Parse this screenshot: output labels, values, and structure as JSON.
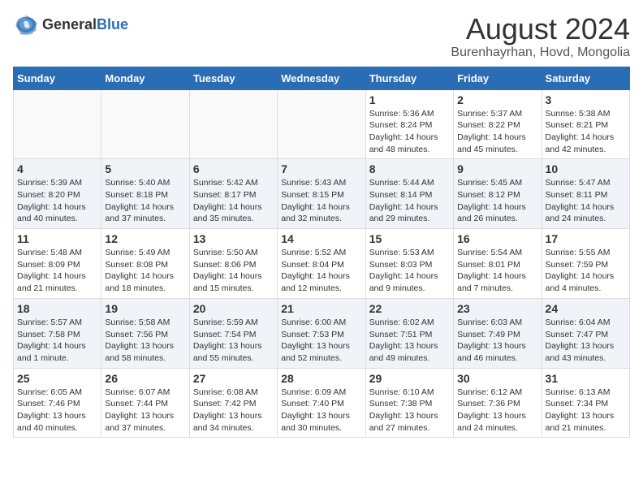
{
  "logo": {
    "general": "General",
    "blue": "Blue"
  },
  "title": "August 2024",
  "subtitle": "Burenhayrhan, Hovd, Mongolia",
  "weekdays": [
    "Sunday",
    "Monday",
    "Tuesday",
    "Wednesday",
    "Thursday",
    "Friday",
    "Saturday"
  ],
  "weeks": [
    [
      {
        "day": "",
        "info": ""
      },
      {
        "day": "",
        "info": ""
      },
      {
        "day": "",
        "info": ""
      },
      {
        "day": "",
        "info": ""
      },
      {
        "day": "1",
        "info": "Sunrise: 5:36 AM\nSunset: 8:24 PM\nDaylight: 14 hours\nand 48 minutes."
      },
      {
        "day": "2",
        "info": "Sunrise: 5:37 AM\nSunset: 8:22 PM\nDaylight: 14 hours\nand 45 minutes."
      },
      {
        "day": "3",
        "info": "Sunrise: 5:38 AM\nSunset: 8:21 PM\nDaylight: 14 hours\nand 42 minutes."
      }
    ],
    [
      {
        "day": "4",
        "info": "Sunrise: 5:39 AM\nSunset: 8:20 PM\nDaylight: 14 hours\nand 40 minutes."
      },
      {
        "day": "5",
        "info": "Sunrise: 5:40 AM\nSunset: 8:18 PM\nDaylight: 14 hours\nand 37 minutes."
      },
      {
        "day": "6",
        "info": "Sunrise: 5:42 AM\nSunset: 8:17 PM\nDaylight: 14 hours\nand 35 minutes."
      },
      {
        "day": "7",
        "info": "Sunrise: 5:43 AM\nSunset: 8:15 PM\nDaylight: 14 hours\nand 32 minutes."
      },
      {
        "day": "8",
        "info": "Sunrise: 5:44 AM\nSunset: 8:14 PM\nDaylight: 14 hours\nand 29 minutes."
      },
      {
        "day": "9",
        "info": "Sunrise: 5:45 AM\nSunset: 8:12 PM\nDaylight: 14 hours\nand 26 minutes."
      },
      {
        "day": "10",
        "info": "Sunrise: 5:47 AM\nSunset: 8:11 PM\nDaylight: 14 hours\nand 24 minutes."
      }
    ],
    [
      {
        "day": "11",
        "info": "Sunrise: 5:48 AM\nSunset: 8:09 PM\nDaylight: 14 hours\nand 21 minutes."
      },
      {
        "day": "12",
        "info": "Sunrise: 5:49 AM\nSunset: 8:08 PM\nDaylight: 14 hours\nand 18 minutes."
      },
      {
        "day": "13",
        "info": "Sunrise: 5:50 AM\nSunset: 8:06 PM\nDaylight: 14 hours\nand 15 minutes."
      },
      {
        "day": "14",
        "info": "Sunrise: 5:52 AM\nSunset: 8:04 PM\nDaylight: 14 hours\nand 12 minutes."
      },
      {
        "day": "15",
        "info": "Sunrise: 5:53 AM\nSunset: 8:03 PM\nDaylight: 14 hours\nand 9 minutes."
      },
      {
        "day": "16",
        "info": "Sunrise: 5:54 AM\nSunset: 8:01 PM\nDaylight: 14 hours\nand 7 minutes."
      },
      {
        "day": "17",
        "info": "Sunrise: 5:55 AM\nSunset: 7:59 PM\nDaylight: 14 hours\nand 4 minutes."
      }
    ],
    [
      {
        "day": "18",
        "info": "Sunrise: 5:57 AM\nSunset: 7:58 PM\nDaylight: 14 hours\nand 1 minute."
      },
      {
        "day": "19",
        "info": "Sunrise: 5:58 AM\nSunset: 7:56 PM\nDaylight: 13 hours\nand 58 minutes."
      },
      {
        "day": "20",
        "info": "Sunrise: 5:59 AM\nSunset: 7:54 PM\nDaylight: 13 hours\nand 55 minutes."
      },
      {
        "day": "21",
        "info": "Sunrise: 6:00 AM\nSunset: 7:53 PM\nDaylight: 13 hours\nand 52 minutes."
      },
      {
        "day": "22",
        "info": "Sunrise: 6:02 AM\nSunset: 7:51 PM\nDaylight: 13 hours\nand 49 minutes."
      },
      {
        "day": "23",
        "info": "Sunrise: 6:03 AM\nSunset: 7:49 PM\nDaylight: 13 hours\nand 46 minutes."
      },
      {
        "day": "24",
        "info": "Sunrise: 6:04 AM\nSunset: 7:47 PM\nDaylight: 13 hours\nand 43 minutes."
      }
    ],
    [
      {
        "day": "25",
        "info": "Sunrise: 6:05 AM\nSunset: 7:46 PM\nDaylight: 13 hours\nand 40 minutes."
      },
      {
        "day": "26",
        "info": "Sunrise: 6:07 AM\nSunset: 7:44 PM\nDaylight: 13 hours\nand 37 minutes."
      },
      {
        "day": "27",
        "info": "Sunrise: 6:08 AM\nSunset: 7:42 PM\nDaylight: 13 hours\nand 34 minutes."
      },
      {
        "day": "28",
        "info": "Sunrise: 6:09 AM\nSunset: 7:40 PM\nDaylight: 13 hours\nand 30 minutes."
      },
      {
        "day": "29",
        "info": "Sunrise: 6:10 AM\nSunset: 7:38 PM\nDaylight: 13 hours\nand 27 minutes."
      },
      {
        "day": "30",
        "info": "Sunrise: 6:12 AM\nSunset: 7:36 PM\nDaylight: 13 hours\nand 24 minutes."
      },
      {
        "day": "31",
        "info": "Sunrise: 6:13 AM\nSunset: 7:34 PM\nDaylight: 13 hours\nand 21 minutes."
      }
    ]
  ]
}
